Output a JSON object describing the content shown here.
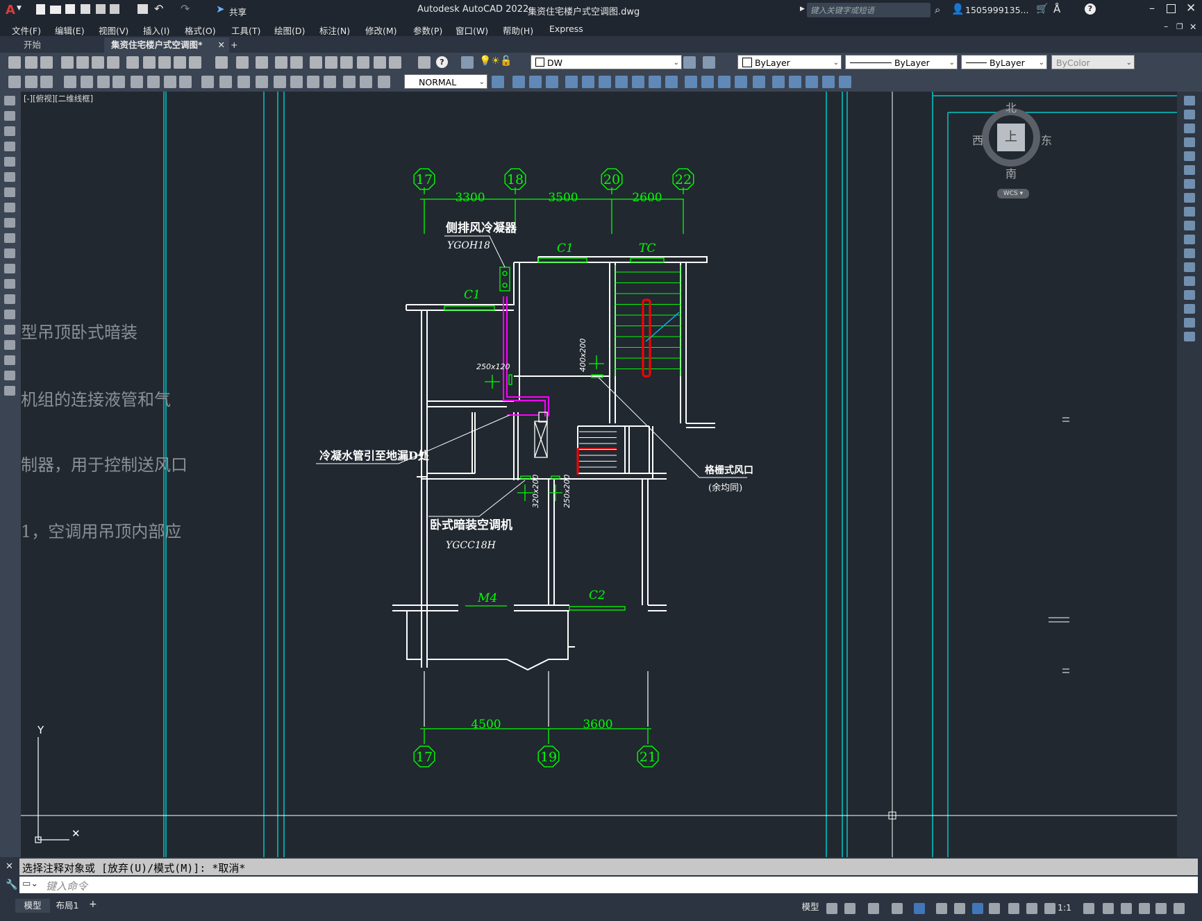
{
  "title_bar": {
    "app_title": "Autodesk AutoCAD 2022",
    "file_name": "集资住宅楼户式空调图.dwg",
    "share_label": "共享",
    "search_placeholder": "键入关键字或短语",
    "user_name": "1505999135..."
  },
  "menu": [
    "文件(F)",
    "编辑(E)",
    "视图(V)",
    "插入(I)",
    "格式(O)",
    "工具(T)",
    "绘图(D)",
    "标注(N)",
    "修改(M)",
    "参数(P)",
    "窗口(W)",
    "帮助(H)",
    "Express"
  ],
  "tabs": {
    "start": "开始",
    "drawing": "集资住宅楼户式空调图*",
    "add": "+"
  },
  "toolbar": {
    "layer": "DW",
    "color": "ByLayer",
    "linetype": "ByLayer",
    "lineweight": "ByLayer",
    "plotstyle": "ByColor",
    "textstyle": "NORMAL"
  },
  "viewport_label": "[-][俯视][二维线框]",
  "viewcube": {
    "north": "北",
    "south": "南",
    "east": "东",
    "west": "西",
    "top": "上",
    "ucs": "WCS"
  },
  "left_notes": [
    "型吊顶卧式暗装",
    "机组的连接液管和气",
    "制器，用于控制送风口",
    "1，空调用吊顶内部应"
  ],
  "drawing": {
    "top_axes": [
      "17",
      "18",
      "20",
      "22"
    ],
    "top_dims": [
      "3300",
      "3500",
      "2600"
    ],
    "bottom_axes": [
      "17",
      "19",
      "21"
    ],
    "bottom_dims": [
      "4500",
      "3600"
    ],
    "window_labels": {
      "c1_top": "C1",
      "tc": "TC",
      "c1_left": "C1",
      "m4": "M4",
      "c2": "C2"
    },
    "condenser_label": "侧排风冷凝器",
    "condenser_model": "YGOH18",
    "ac_label": "卧式暗装空调机",
    "ac_model": "YGCC18H",
    "drain_label": "冷凝水管引至地漏D处",
    "vent_label": "格栅式风口",
    "vent_sub": "(余均同)",
    "duct_sizes": [
      "250x120",
      "400x200",
      "320x200",
      "250x200"
    ]
  },
  "command": {
    "history": "选择注释对象或 [放弃(U)/模式(M)]: *取消*",
    "input_placeholder": "键入命令"
  },
  "status": {
    "model_tab": "模型",
    "layout_tab": "布局1",
    "add": "+",
    "mode": "模型",
    "scale": "1:1"
  },
  "colors": {
    "axis_green": "#00ff00",
    "wall": "#ffffff",
    "duct": "#ff00ff",
    "frame": "#00c8c8",
    "red": "#ff0000"
  }
}
